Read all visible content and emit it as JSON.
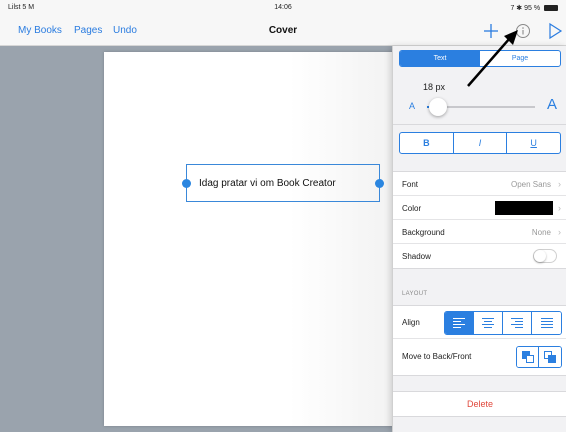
{
  "status": {
    "carrier": "Lilst 5 M",
    "time": "14:06",
    "battery": "7 ✱ 95 %"
  },
  "nav": {
    "my_books": "My Books",
    "pages": "Pages",
    "undo": "Undo",
    "title": "Cover",
    "add_icon": "plus-icon",
    "info_icon": "info-icon",
    "play_icon": "play-icon"
  },
  "page": {
    "text": "Idag pratar vi om Book Creator"
  },
  "inspector": {
    "tabs": [
      {
        "label": "Text",
        "active": true
      },
      {
        "label": "Page",
        "active": false
      }
    ],
    "font_size": "18 px",
    "slider_small_label": "A",
    "slider_big_label": "A",
    "slider_level": 0.1,
    "bold": "B",
    "italic": "I",
    "underline": "U",
    "font_label": "Font",
    "font_value": "Open Sans",
    "color_label": "Color",
    "color_value": "#000000",
    "background_label": "Background",
    "background_value": "None",
    "shadow_label": "Shadow",
    "shadow_on": false,
    "layout_header": "LAYOUT",
    "align_label": "Align",
    "align_selected": "left",
    "move_label": "Move to Back/Front",
    "delete_label": "Delete"
  },
  "colors": {
    "accent": "#2b7fe0",
    "delete": "#e0483c",
    "canvas_bg": "#9aa3ad"
  }
}
